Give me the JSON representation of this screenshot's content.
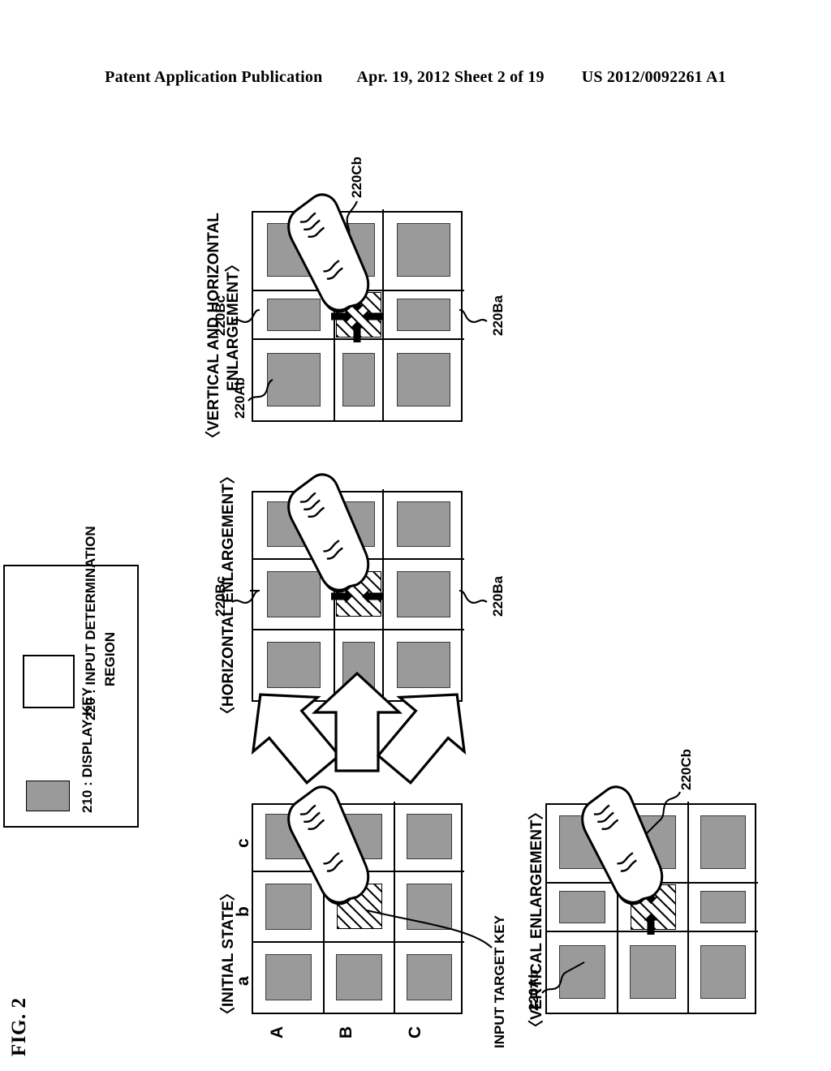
{
  "header": {
    "publication": "Patent Application Publication",
    "date_sheet": "Apr. 19, 2012  Sheet 2 of 19",
    "patent_number": "US 2012/0092261 A1"
  },
  "figure": {
    "title": "FIG. 2",
    "legend": {
      "display_key": "210 : DISPLAY KEY",
      "input_determination_region_line1": "220 : INPUT DETERMINATION",
      "input_determination_region_line2": "REGION"
    },
    "callouts": {
      "input_target_key": "INPUT TARGET KEY"
    },
    "panels": {
      "initial": {
        "title": "〈INITIAL STATE〉",
        "col_labels": [
          "a",
          "b",
          "c"
        ],
        "row_labels": [
          "A",
          "B",
          "C"
        ]
      },
      "vertical": {
        "title": "〈VERTICAL ENLARGEMENT〉",
        "refs": [
          "220Ab",
          "220Cb"
        ]
      },
      "horizontal": {
        "title": "〈HORIZONTAL ENLARGEMENT〉",
        "refs": [
          "220Bc",
          "220Ba"
        ]
      },
      "both": {
        "title_line1": "〈VERTICAL AND HORIZONTAL",
        "title_line2": "ENLARGEMENT〉",
        "refs": [
          "220Ab",
          "220Bc",
          "220Cb",
          "220Ba"
        ]
      }
    },
    "colors": {
      "display_key_fill": "#9a9a9a",
      "line": "#000000",
      "background": "#ffffff"
    }
  }
}
